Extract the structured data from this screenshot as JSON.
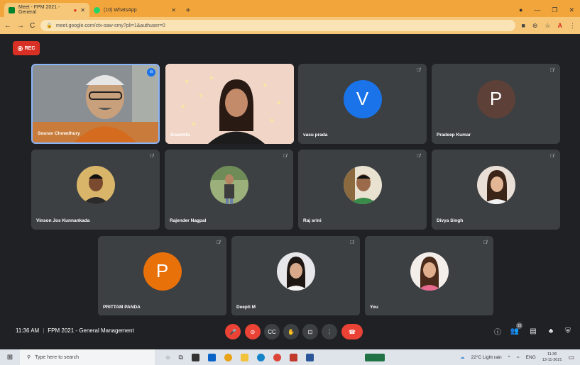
{
  "browser": {
    "tabs": [
      {
        "label": "Meet - FPM 2021 - General",
        "active": true,
        "icon": "meet-icon"
      },
      {
        "label": "(10) WhatsApp",
        "active": false,
        "icon": "whatsapp-icon"
      }
    ],
    "url": "meet.google.com/ctx-oaw-smy?pli=1&authuser=0"
  },
  "recording": {
    "label": "REC"
  },
  "participants": [
    {
      "name": "Sourav Chowdhury",
      "type": "video",
      "speaking": true
    },
    {
      "name": "Sreemita",
      "type": "video"
    },
    {
      "name": "vasu prada",
      "type": "letter",
      "letter": "V",
      "color": "#1a73e8"
    },
    {
      "name": "Pradeep Kumar",
      "type": "letter",
      "letter": "P",
      "color": "#5d4037"
    },
    {
      "name": "Vinson Jos Kunnankada",
      "type": "photo"
    },
    {
      "name": "Rajender Nagpal",
      "type": "photo"
    },
    {
      "name": "Raj srini",
      "type": "photo"
    },
    {
      "name": "Divya Singh",
      "type": "photo"
    },
    {
      "name": "PRITTAM PANDA",
      "type": "letter",
      "letter": "P",
      "color": "#e8710a"
    },
    {
      "name": "Deepti M",
      "type": "photo"
    },
    {
      "name": "You",
      "type": "photo"
    }
  ],
  "meeting": {
    "time": "11:36 AM",
    "title": "FPM 2021 - General Management",
    "participant_count": "15"
  },
  "taskbar": {
    "search_placeholder": "Type here to search",
    "weather": "22°C Light rain",
    "lang": "ENG",
    "time": "11:36",
    "date": "13-11-2021"
  }
}
